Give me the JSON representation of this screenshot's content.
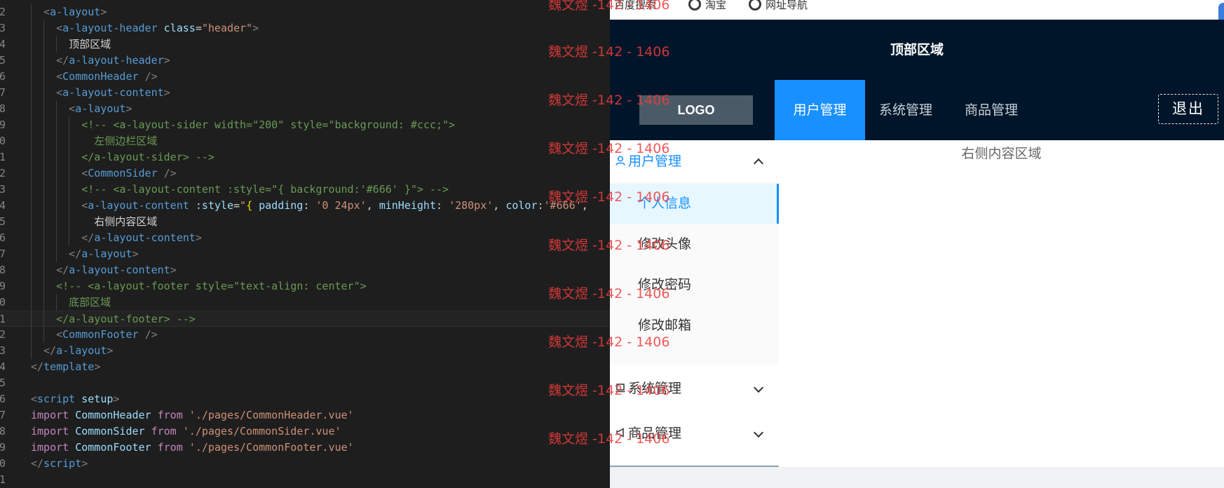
{
  "editor": {
    "lines": [
      {
        "n": "2",
        "tokens": [
          [
            "t-br",
            "  <"
          ],
          [
            "t-tag",
            "a-layout"
          ],
          [
            "t-br",
            ">"
          ]
        ]
      },
      {
        "n": "3",
        "tokens": [
          [
            "t-br",
            "    <"
          ],
          [
            "t-tag",
            "a-layout-header"
          ],
          [
            "t-txt",
            " "
          ],
          [
            "t-attr",
            "class"
          ],
          [
            "t-txt",
            "="
          ],
          [
            "t-str",
            "\"header\""
          ],
          [
            "t-br",
            ">"
          ]
        ]
      },
      {
        "n": "4",
        "tokens": [
          [
            "t-txt",
            "      顶部区域"
          ]
        ]
      },
      {
        "n": "5",
        "tokens": [
          [
            "t-br",
            "    </"
          ],
          [
            "t-tag",
            "a-layout-header"
          ],
          [
            "t-br",
            ">"
          ]
        ]
      },
      {
        "n": "6",
        "tokens": [
          [
            "t-br",
            "    <"
          ],
          [
            "t-tag",
            "CommonHeader"
          ],
          [
            "t-txt",
            " "
          ],
          [
            "t-br",
            "/>"
          ]
        ]
      },
      {
        "n": "7",
        "tokens": [
          [
            "t-br",
            "    <"
          ],
          [
            "t-tag",
            "a-layout-content"
          ],
          [
            "t-br",
            ">"
          ]
        ]
      },
      {
        "n": "8",
        "tokens": [
          [
            "t-br",
            "      <"
          ],
          [
            "t-tag",
            "a-layout"
          ],
          [
            "t-br",
            ">"
          ]
        ]
      },
      {
        "n": "9",
        "tokens": [
          [
            "t-com",
            "        <!-- <a-layout-sider width=\"200\" style=\"background: #ccc;\">"
          ]
        ]
      },
      {
        "n": "0",
        "tokens": [
          [
            "t-com",
            "          左侧边栏区域"
          ]
        ]
      },
      {
        "n": "1",
        "tokens": [
          [
            "t-com",
            "        </a-layout-sider> -->"
          ]
        ]
      },
      {
        "n": "2",
        "tokens": [
          [
            "t-br",
            "        <"
          ],
          [
            "t-tag",
            "CommonSider"
          ],
          [
            "t-txt",
            " "
          ],
          [
            "t-br",
            "/>"
          ]
        ]
      },
      {
        "n": "3",
        "tokens": [
          [
            "t-com",
            "        <!-- <a-layout-content :style=\"{ background:'#666' }\"> -->"
          ]
        ]
      },
      {
        "n": "4",
        "tokens": [
          [
            "t-br",
            "        <"
          ],
          [
            "t-tag",
            "a-layout-content"
          ],
          [
            "t-txt",
            " "
          ],
          [
            "t-attr",
            ":style"
          ],
          [
            "t-txt",
            "="
          ],
          [
            "t-str",
            "\""
          ],
          [
            "t-gold",
            "{"
          ],
          [
            "t-txt",
            " "
          ],
          [
            "t-id",
            "padding"
          ],
          [
            "t-txt",
            ": "
          ],
          [
            "t-str",
            "'0 24px'"
          ],
          [
            "t-txt",
            ", "
          ],
          [
            "t-id",
            "minHeight"
          ],
          [
            "t-txt",
            ": "
          ],
          [
            "t-str",
            "'280px'"
          ],
          [
            "t-txt",
            ", "
          ],
          [
            "t-id",
            "color"
          ],
          [
            "t-txt",
            ":"
          ],
          [
            "t-str",
            "'#666'"
          ],
          [
            "t-txt",
            ","
          ]
        ]
      },
      {
        "n": "5",
        "tokens": [
          [
            "t-txt",
            "          右侧内容区域"
          ]
        ]
      },
      {
        "n": "6",
        "tokens": [
          [
            "t-br",
            "        </"
          ],
          [
            "t-tag",
            "a-layout-content"
          ],
          [
            "t-br",
            ">"
          ]
        ]
      },
      {
        "n": "7",
        "tokens": [
          [
            "t-br",
            "      </"
          ],
          [
            "t-tag",
            "a-layout"
          ],
          [
            "t-br",
            ">"
          ]
        ]
      },
      {
        "n": "8",
        "tokens": [
          [
            "t-br",
            "    </"
          ],
          [
            "t-tag",
            "a-layout-content"
          ],
          [
            "t-br",
            ">"
          ]
        ]
      },
      {
        "n": "9",
        "tokens": [
          [
            "t-com",
            "    <!-- <a-layout-footer style=\"text-align: center\">"
          ]
        ]
      },
      {
        "n": "0",
        "tokens": [
          [
            "t-com",
            "      底部区域"
          ]
        ]
      },
      {
        "n": "1",
        "tokens": [
          [
            "t-com",
            "    </a-layout-footer> -->"
          ]
        ],
        "active": true
      },
      {
        "n": "2",
        "tokens": [
          [
            "t-br",
            "    <"
          ],
          [
            "t-tag",
            "CommonFooter"
          ],
          [
            "t-txt",
            " "
          ],
          [
            "t-br",
            "/>"
          ]
        ]
      },
      {
        "n": "3",
        "tokens": [
          [
            "t-br",
            "  </"
          ],
          [
            "t-tag",
            "a-layout"
          ],
          [
            "t-br",
            ">"
          ]
        ]
      },
      {
        "n": "4",
        "tokens": [
          [
            "t-br",
            "</"
          ],
          [
            "t-tag",
            "template"
          ],
          [
            "t-br",
            ">"
          ]
        ]
      },
      {
        "n": "5",
        "tokens": []
      },
      {
        "n": "6",
        "tokens": [
          [
            "t-br",
            "<"
          ],
          [
            "t-tag",
            "script"
          ],
          [
            "t-txt",
            " "
          ],
          [
            "t-attr",
            "setup"
          ],
          [
            "t-br",
            ">"
          ]
        ]
      },
      {
        "n": "7",
        "tokens": [
          [
            "t-kw",
            "import"
          ],
          [
            "t-txt",
            " "
          ],
          [
            "t-id",
            "CommonHeader"
          ],
          [
            "t-txt",
            " "
          ],
          [
            "t-kw",
            "from"
          ],
          [
            "t-txt",
            " "
          ],
          [
            "t-str",
            "'./pages/CommonHeader.vue'"
          ]
        ]
      },
      {
        "n": "8",
        "tokens": [
          [
            "t-kw",
            "import"
          ],
          [
            "t-txt",
            " "
          ],
          [
            "t-id",
            "CommonSider"
          ],
          [
            "t-txt",
            " "
          ],
          [
            "t-kw",
            "from"
          ],
          [
            "t-txt",
            " "
          ],
          [
            "t-str",
            "'./pages/CommonSider.vue'"
          ]
        ]
      },
      {
        "n": "9",
        "tokens": [
          [
            "t-kw",
            "import"
          ],
          [
            "t-txt",
            " "
          ],
          [
            "t-id",
            "CommonFooter"
          ],
          [
            "t-txt",
            " "
          ],
          [
            "t-kw",
            "from"
          ],
          [
            "t-txt",
            " "
          ],
          [
            "t-str",
            "'./pages/CommonFooter.vue'"
          ]
        ]
      },
      {
        "n": "0",
        "tokens": [
          [
            "t-br",
            "</"
          ],
          [
            "t-tag",
            "script"
          ],
          [
            "t-br",
            ">"
          ]
        ]
      },
      {
        "n": "1",
        "tokens": []
      }
    ]
  },
  "bookmarks": [
    {
      "label": "百度搜索",
      "icon": "baidu-icon"
    },
    {
      "label": "淘宝",
      "icon": "globe-icon"
    },
    {
      "label": "网址导航",
      "icon": "globe-icon"
    }
  ],
  "header": {
    "top_title": "顶部区域",
    "logo": "LOGO",
    "nav": [
      "用户管理",
      "系统管理",
      "商品管理"
    ],
    "active_nav": 0,
    "logout": "退出"
  },
  "sider": {
    "open_group": "用户管理",
    "items": [
      "个人信息",
      "修改头像",
      "修改密码",
      "修改邮箱"
    ],
    "selected": "个人信息",
    "groups": [
      "系统管理",
      "商品管理"
    ]
  },
  "content": {
    "text": "右侧内容区域"
  },
  "watermark": "魏文煜 -142 - 1406",
  "colors": {
    "dark": "#001529",
    "accent": "#1890ff",
    "watermark": "#ec3c3c"
  }
}
